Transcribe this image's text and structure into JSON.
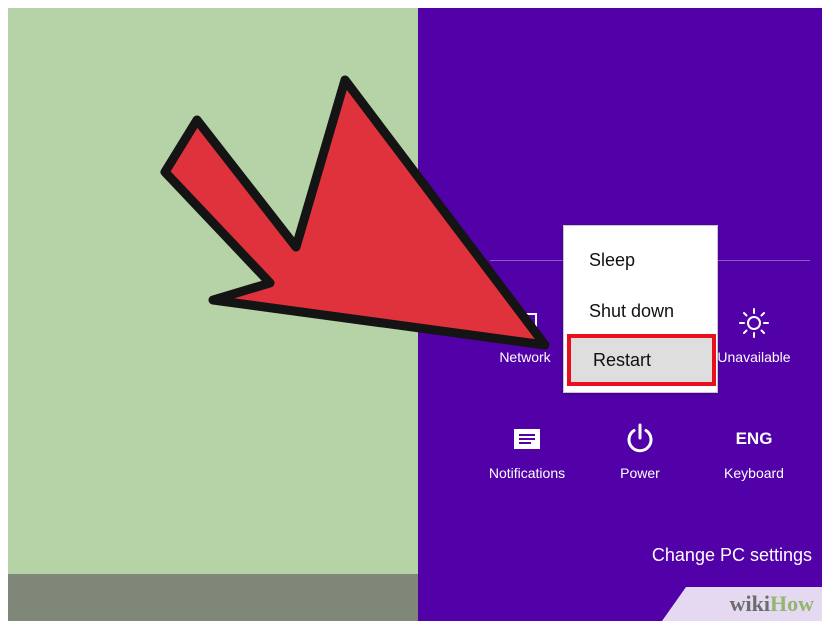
{
  "power_menu": {
    "items": [
      {
        "label": "Sleep"
      },
      {
        "label": "Shut down"
      },
      {
        "label": "Restart"
      }
    ],
    "highlighted": "Restart"
  },
  "settings_tiles": {
    "network": {
      "label": "Network",
      "icon": "network-icon"
    },
    "brightness": {
      "label": "Unavailable",
      "icon": "brightness-icon"
    },
    "notifications": {
      "label": "Notifications",
      "icon": "notifications-icon"
    },
    "power": {
      "label": "Power",
      "icon": "power-icon"
    },
    "keyboard": {
      "label": "Keyboard",
      "icon_text": "ENG"
    }
  },
  "footer": {
    "change_pc_settings": "Change PC settings"
  },
  "watermark": {
    "wiki": "wiki",
    "how": "How"
  },
  "colors": {
    "charms_background": "#5200a8",
    "desktop_background": "#b5d3a6",
    "arrow_fill": "#e0323c",
    "highlight_border": "#e8101c"
  }
}
